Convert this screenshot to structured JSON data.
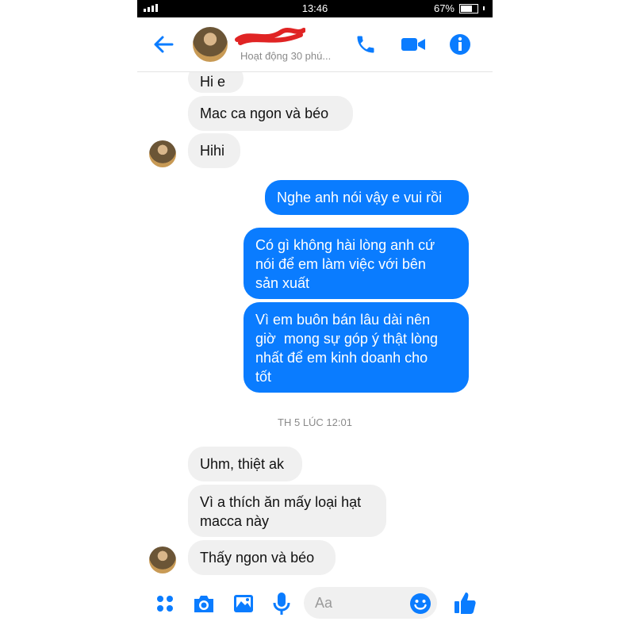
{
  "status_bar": {
    "time": "13:46",
    "battery": "67%"
  },
  "header": {
    "subtitle": "Hoạt động 30 phú...",
    "icons": [
      "back-arrow-icon",
      "phone-icon",
      "video-icon",
      "info-icon"
    ]
  },
  "messages": [
    {
      "side": "in",
      "text": "Hi e"
    },
    {
      "side": "in",
      "text": "Mac ca ngon và béo"
    },
    {
      "side": "in",
      "text": "Hihi"
    },
    {
      "side": "out",
      "text": "Nghe anh nói vậy e vui rồi"
    },
    {
      "side": "out",
      "text": "Có gì không hài lòng anh cứ\nnói để em làm việc với bên\nsản xuất"
    },
    {
      "side": "out",
      "text": "Vì em buôn bán lâu dài nên\ngiờ  mong sự góp ý thật lòng\nnhất để em kinh doanh cho\ntốt"
    },
    {
      "side": "in",
      "text": "Uhm, thiệt ak"
    },
    {
      "side": "in",
      "text": "Vì a thích ăn mấy loại hạt\nmacca này"
    },
    {
      "side": "in",
      "text": "Thấy ngon và béo"
    }
  ],
  "timestamp": "TH 5 LÚC 12:01",
  "composer": {
    "placeholder": "Aa",
    "icons": [
      "apps-icon",
      "camera-icon",
      "gallery-icon",
      "mic-icon",
      "emoji-icon",
      "like-icon"
    ]
  },
  "colors": {
    "accent": "#0a7cff",
    "incoming_bubble": "#f0f0f0"
  }
}
